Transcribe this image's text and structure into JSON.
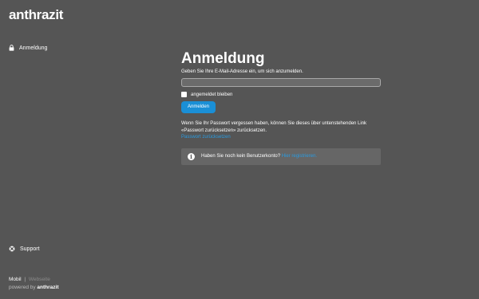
{
  "brand": "anthrazit",
  "sidebar": {
    "login_label": "Anmeldung",
    "support_label": "Support"
  },
  "footer": {
    "mobile_label": "Mobil",
    "separator": "|",
    "website_label": "Webseite",
    "powered_prefix": "powered by",
    "powered_brand": "anthrazit"
  },
  "form": {
    "title": "Anmeldung",
    "intro": "Geben Sie Ihre E-Mail-Adresse ein, um sich anzumelden.",
    "email_value": "",
    "email_placeholder": "",
    "remember_label": "angemeldet bleiben",
    "submit_label": "Anmelden",
    "forgot_text": "Wenn Sie Ihr Passwort vergessen haben, können Sie dieses über untenstehenden Link «Passwort zurücksetzen» zurücksetzen.",
    "forgot_link": "Passwort zurücksetzen"
  },
  "register": {
    "question": "Haben Sie noch kein Benutzerkonto?",
    "link": "Hier registrieren."
  },
  "colors": {
    "background": "#555555",
    "accent": "#1a8fd6",
    "link": "#2a9be0"
  },
  "icons": {
    "login": "lock-icon",
    "support": "lifebuoy-icon",
    "info": "info-icon"
  }
}
